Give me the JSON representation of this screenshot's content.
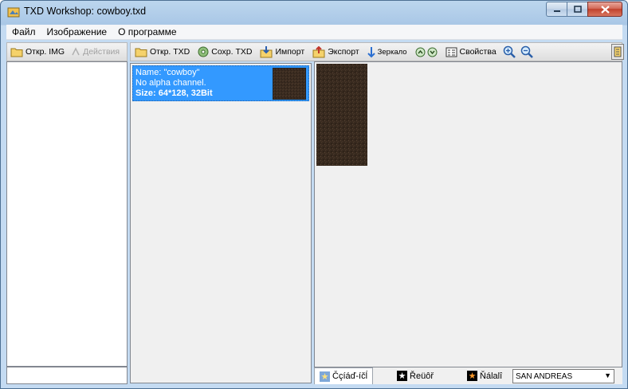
{
  "window": {
    "title": "TXD Workshop: cowboy.txd"
  },
  "menu": {
    "items": [
      "Файл",
      "Изображение",
      "О программе"
    ]
  },
  "left_toolbar": {
    "open_img": "Откр. IMG",
    "actions": "Действия"
  },
  "main_toolbar": {
    "open_txd": "Откр. TXD",
    "save_txd": "Сохр. TXD",
    "import": "Импорт",
    "export": "Экспорт",
    "mirror": "Зеркало",
    "properties": "Свойства"
  },
  "texture": {
    "name": "Name: \"cowboy\"",
    "alpha": "No alpha channel.",
    "size": "Size: 64*128, 32Bit"
  },
  "bottom_tabs": [
    "Čçíáď-íčĺ",
    "Řeüôř",
    "Ňálalî"
  ],
  "game_select": {
    "value": "SAN ANDREAS"
  },
  "colors": {
    "selection": "#3399ff",
    "texture_brown": "#3a2b20"
  }
}
